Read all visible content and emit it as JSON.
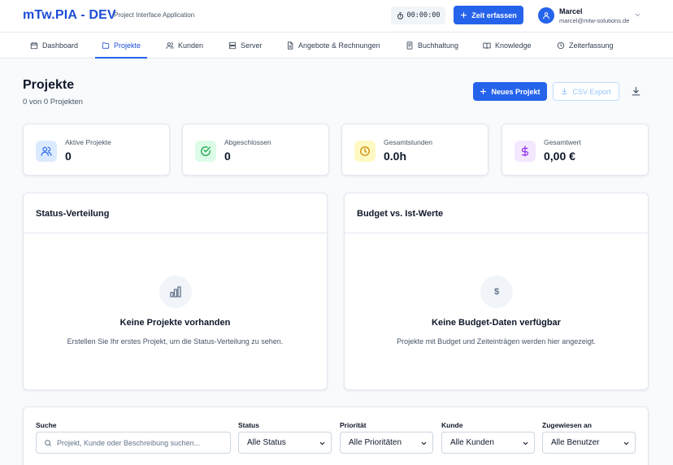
{
  "header": {
    "brand": "mTw.PIA - DEV",
    "subtitle": "Project Interface Application",
    "timer": "00:00:00",
    "track_time_label": "Zeit erfassen",
    "user": {
      "name": "Marcel",
      "email": "marcel@mtw-solutions.de"
    }
  },
  "nav": {
    "items": [
      {
        "label": "Dashboard",
        "icon": "calendar-icon"
      },
      {
        "label": "Projekte",
        "icon": "folder-icon",
        "active": true
      },
      {
        "label": "Kunden",
        "icon": "users-icon"
      },
      {
        "label": "Server",
        "icon": "server-icon"
      },
      {
        "label": "Angebote & Rechnungen",
        "icon": "document-icon"
      },
      {
        "label": "Buchhaltung",
        "icon": "ledger-icon"
      },
      {
        "label": "Knowledge",
        "icon": "book-icon"
      },
      {
        "label": "Zeiterfassung",
        "icon": "clock-icon"
      }
    ]
  },
  "page": {
    "title": "Projekte",
    "count_text": "0 von 0 Projekten",
    "new_project_label": "Neues Projekt",
    "csv_export_label": "CSV Export"
  },
  "stats": [
    {
      "label": "Aktive Projekte",
      "value": "0",
      "icon": "users-icon",
      "color": "#2563eb",
      "bg": "#dbeafe"
    },
    {
      "label": "Abgeschlossen",
      "value": "0",
      "icon": "check-circle-icon",
      "color": "#16a34a",
      "bg": "#dcfce7"
    },
    {
      "label": "Gesamtstunden",
      "value": "0.0h",
      "icon": "clock-icon",
      "color": "#ca8a04",
      "bg": "#fef9c3"
    },
    {
      "label": "Gesamtwert",
      "value": "0,00 €",
      "icon": "dollar-icon",
      "color": "#9333ea",
      "bg": "#f3e8ff"
    }
  ],
  "panels": {
    "status": {
      "title": "Status-Verteilung",
      "empty_title": "Keine Projekte vorhanden",
      "empty_desc": "Erstellen Sie Ihr erstes Projekt, um die Status-Verteilung zu sehen."
    },
    "budget": {
      "title": "Budget vs. Ist-Werte",
      "empty_icon_text": "$",
      "empty_title": "Keine Budget-Daten verfügbar",
      "empty_desc": "Projekte mit Budget und Zeiteinträgen werden hier angezeigt."
    }
  },
  "filters": {
    "search_label": "Suche",
    "search_placeholder": "Projekt, Kunde oder Beschreibung suchen...",
    "status": {
      "label": "Status",
      "value": "Alle Status"
    },
    "priority": {
      "label": "Priorität",
      "value": "Alle Prioritäten"
    },
    "customer": {
      "label": "Kunde",
      "value": "Alle Kunden"
    },
    "assignee": {
      "label": "Zugewiesen an",
      "value": "Alle Benutzer"
    }
  },
  "colors": {
    "primary": "#2563eb",
    "brand": "#1d4ed8",
    "border": "#e2e8f0",
    "background": "#f8fafc"
  }
}
